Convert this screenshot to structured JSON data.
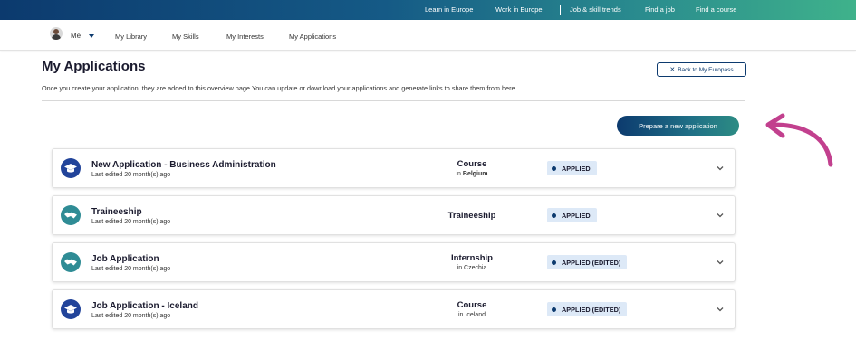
{
  "topnav": {
    "links": [
      "Learn in Europe",
      "Work in Europe",
      "Job & skill trends",
      "Find a job",
      "Find a course"
    ]
  },
  "subnav": {
    "me_label": "Me",
    "items": [
      "My Library",
      "My Skills",
      "My Interests",
      "My Applications"
    ]
  },
  "page": {
    "title": "My Applications",
    "intro": "Once you create your application, they are added to this overview page.You can update or download your applications and generate links to share them from here.",
    "back_label": "Back to My Europass",
    "prepare_label": "Prepare a new application"
  },
  "applications": [
    {
      "name": "New Application - Business Administration",
      "edited": "Last edited 20 month(s) ago",
      "type": "Course",
      "location_prefix": "in",
      "location": "Belgium",
      "status": "APPLIED",
      "icon": "graduation-cap-icon"
    },
    {
      "name": "Traineeship",
      "edited": "Last edited 20 month(s) ago",
      "type": "Traineeship",
      "location_prefix": "",
      "location": "",
      "status": "APPLIED",
      "icon": "handshake-icon"
    },
    {
      "name": "Job Application",
      "edited": "Last edited 20 month(s) ago",
      "type": "Internship",
      "location_prefix": "in",
      "location": "Czechia",
      "status": "APPLIED (EDITED)",
      "icon": "handshake-icon"
    },
    {
      "name": "Job Application - Iceland",
      "edited": "Last edited 20 month(s) ago",
      "type": "Course",
      "location_prefix": "in",
      "location": "Iceland",
      "status": "APPLIED (EDITED)",
      "icon": "graduation-cap-icon"
    }
  ],
  "colors": {
    "primary": "#0c3a6e",
    "accent_teal": "#2d8c84",
    "status_bg": "#dde9f7",
    "annotation_arrow": "#c2408e"
  }
}
